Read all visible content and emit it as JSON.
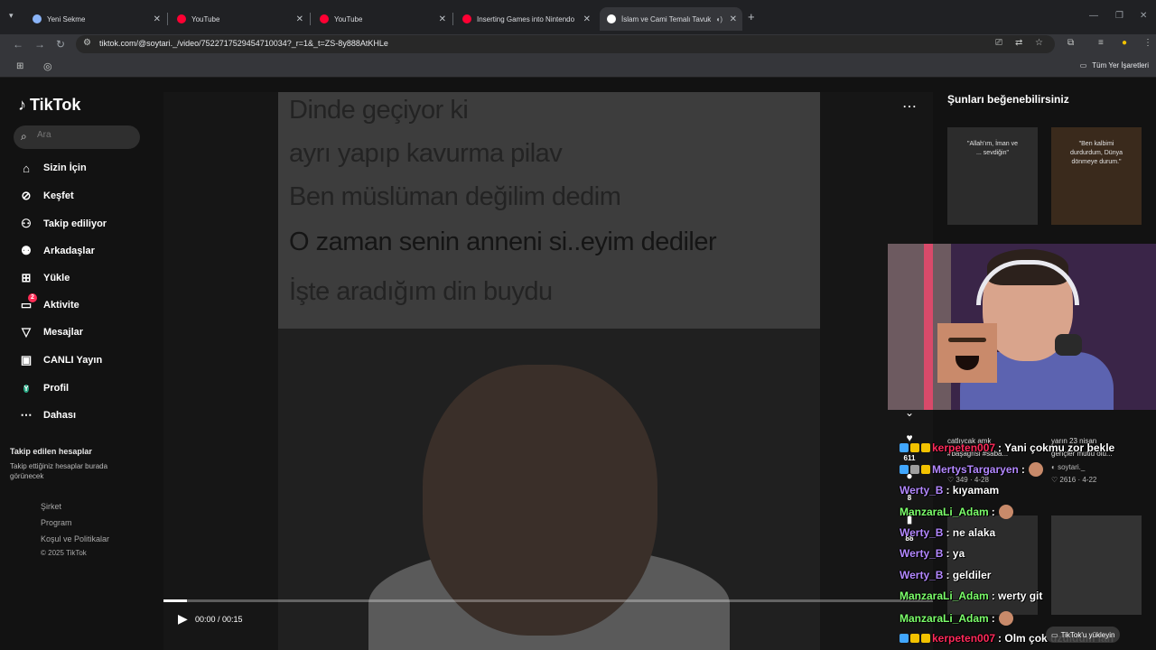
{
  "browser": {
    "tabs": [
      {
        "title": "Yeni Sekme",
        "fav_color": "#8ab4f8",
        "active": false
      },
      {
        "title": "YouTube",
        "fav_color": "#ff0033",
        "active": false
      },
      {
        "title": "YouTube",
        "fav_color": "#ff0033",
        "active": false
      },
      {
        "title": "Inserting Games into Nintendo",
        "fav_color": "#ff0033",
        "active": false
      },
      {
        "title": "İslam ve Cami Temalı Tavuk",
        "fav_color": "#ffffff",
        "active": true
      }
    ],
    "url": "tiktok.com/@soytari._/video/7522717529454710034?_r=1&_t=ZS-8y888AtKHLe",
    "bookmarks_all": "Tüm Yer İşaretleri"
  },
  "tiktok": {
    "logo": "TikTok",
    "search_placeholder": "Ara",
    "nav": [
      {
        "label": "Sizin İçin",
        "icon": "home-icon",
        "glyph": "⌂"
      },
      {
        "label": "Keşfet",
        "icon": "compass-icon",
        "glyph": "⊘"
      },
      {
        "label": "Takip ediliyor",
        "icon": "following-icon",
        "glyph": "⚇"
      },
      {
        "label": "Arkadaşlar",
        "icon": "friends-icon",
        "glyph": "⚉"
      },
      {
        "label": "Yükle",
        "icon": "upload-icon",
        "glyph": "⊞"
      },
      {
        "label": "Aktivite",
        "icon": "activity-icon",
        "glyph": "▭",
        "badge": "2"
      },
      {
        "label": "Mesajlar",
        "icon": "messages-icon",
        "glyph": "▽"
      },
      {
        "label": "CANLI Yayın",
        "icon": "live-icon",
        "glyph": "▣"
      },
      {
        "label": "Profil",
        "icon": "profile-avatar",
        "avatar": "Y"
      },
      {
        "label": "Dahası",
        "icon": "more-icon",
        "glyph": "⋯"
      }
    ],
    "followed_title": "Takip edilen hesaplar",
    "followed_desc": "Takip ettiğiniz hesaplar burada görünecek",
    "footer_links": [
      "Şirket",
      "Program",
      "Koşul ve Politikalar"
    ],
    "copyright": "© 2025 TikTok",
    "video": {
      "text_lines": [
        "Dinde geçiyor ki",
        "ayrı yapıp kavurma pilav",
        "Ben müslüman değilim dedim",
        "O zaman senin anneni si..eyim dediler",
        "İşte aradığım din buydu"
      ],
      "time": "00:00 / 00:15",
      "progress_fraction": 0.03
    },
    "recs_title": "Şunları beğenebilirsiniz",
    "recs": [
      {
        "title": "catlıycak amk",
        "tags": "#başagrisi #saba...",
        "user": "",
        "likes": "",
        "date": "",
        "cap": "\"Allah'ım, İman ve ... sevdiğin\""
      },
      {
        "title": "yarın 23 nisan",
        "tags": "gençler mutlu olu...",
        "user": "soytari._",
        "likes": "2616",
        "date": "4-22",
        "cap": "\"Ben kalbimi durdurdum, Dünya dönmeye durum.\""
      }
    ],
    "rec_left_meta": {
      "likes": "349",
      "date": "4-28"
    },
    "side_actions": {
      "likes": "611",
      "comments": "8",
      "saves": "88"
    }
  },
  "chat": [
    {
      "user": "kerpeten007",
      "color": "#ff2a5a",
      "msg": ": Yani çokmu zor bekle",
      "badges": [
        "#41a7ff",
        "#f2c200",
        "#f2c200"
      ]
    },
    {
      "user": "MertysTargaryen",
      "color": "#b388ff",
      "msg": ":",
      "badges": [
        "#41a7ff",
        "#9e9e9e",
        "#f2c200"
      ],
      "emote": true
    },
    {
      "user": "Werty_B",
      "color": "#b388ff",
      "msg": ": kıyamam",
      "badges": []
    },
    {
      "user": "ManzaraLi_Adam",
      "color": "#7cff6b",
      "msg": ":",
      "badges": [],
      "emote": true
    },
    {
      "user": "Werty_B",
      "color": "#b388ff",
      "msg": ": ne alaka",
      "badges": []
    },
    {
      "user": "Werty_B",
      "color": "#b388ff",
      "msg": ": ya",
      "badges": []
    },
    {
      "user": "Werty_B",
      "color": "#b388ff",
      "msg": ": geldiler",
      "badges": []
    },
    {
      "user": "ManzaraLi_Adam",
      "color": "#7cff6b",
      "msg": ": werty git",
      "badges": []
    },
    {
      "user": "ManzaraLi_Adam",
      "color": "#7cff6b",
      "msg": ":",
      "badges": [],
      "emote": true
    },
    {
      "user": "kerpeten007",
      "color": "#ff2a5a",
      "msg": ": Olm çok üzüldüm lan",
      "badges": [
        "#41a7ff",
        "#f2c200",
        "#f2c200"
      ]
    }
  ],
  "tiktok_pill": "TikTok'u yükleyin"
}
